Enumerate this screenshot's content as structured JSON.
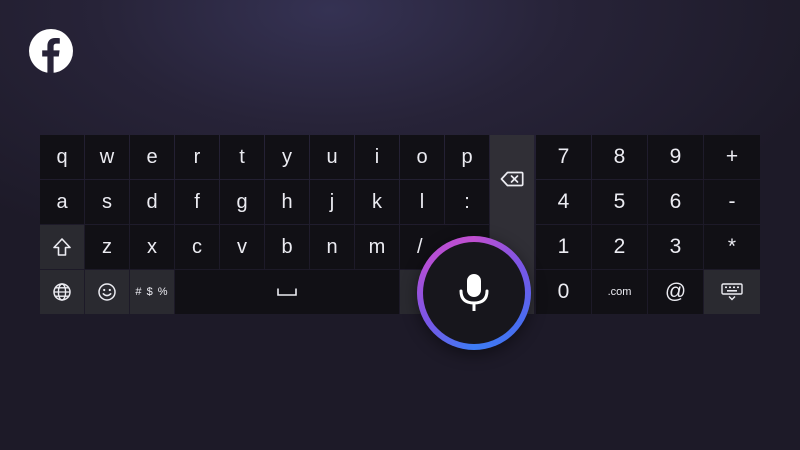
{
  "app": {
    "logo_icon": "facebook-icon"
  },
  "colors": {
    "key_bg": "#111015",
    "special_key_bg": "#2a2a30",
    "background_dark": "#1d1a28",
    "mic_ring_start": "#c04fd0",
    "mic_ring_end": "#3d7cf4"
  },
  "keyboard": {
    "rows": [
      [
        "q",
        "w",
        "e",
        "r",
        "t",
        "y",
        "u",
        "i",
        "o",
        "p"
      ],
      [
        "a",
        "s",
        "d",
        "f",
        "g",
        "h",
        "j",
        "k",
        "l",
        ":"
      ],
      [
        "z",
        "x",
        "c",
        "v",
        "b",
        "n",
        "m",
        "/"
      ]
    ],
    "symbols_label": "# $ %",
    "numpad": {
      "row1": [
        "7",
        "8",
        "9",
        "+"
      ],
      "row2": [
        "4",
        "5",
        "6",
        "-"
      ],
      "row3": [
        "1",
        "2",
        "3",
        "*"
      ],
      "row4": [
        "0",
        ".com",
        "@"
      ]
    },
    "icons": {
      "backspace": "backspace-icon",
      "shift": "shift-icon",
      "language": "globe-icon",
      "emoji": "emoji-icon",
      "space": "space-bar-icon",
      "hide": "keyboard-hide-icon",
      "voice": "microphone-icon"
    }
  }
}
